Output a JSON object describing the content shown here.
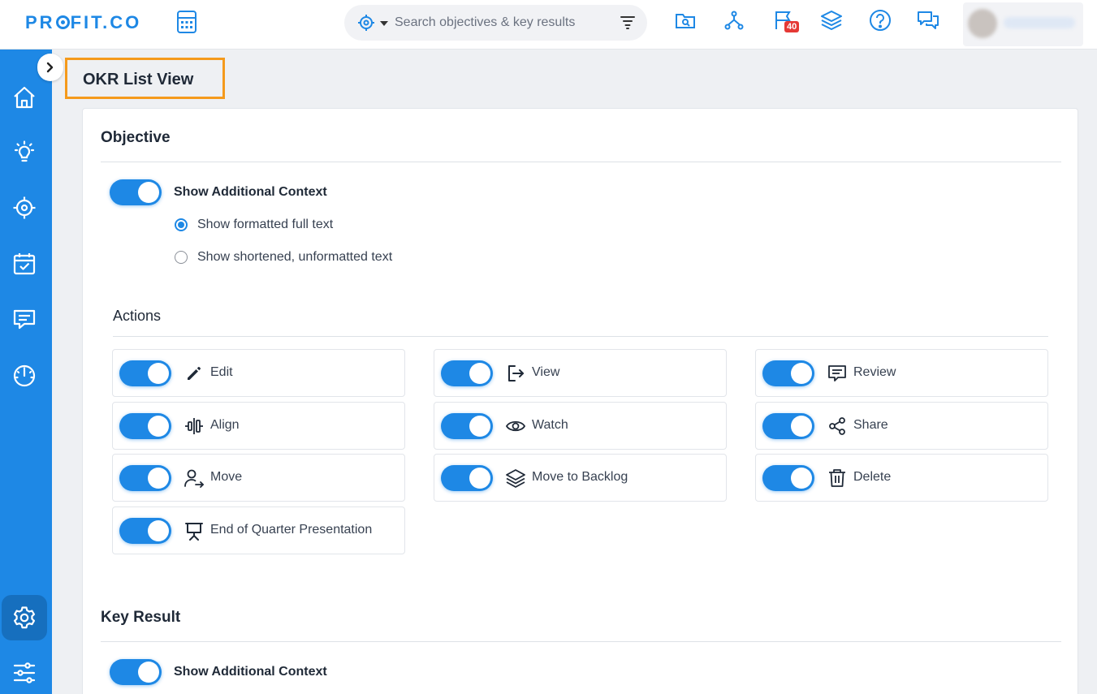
{
  "header": {
    "logo": "PROFIT.CO",
    "search_placeholder": "Search objectives & key results",
    "notification_count": "40"
  },
  "icons": {
    "top": [
      "calculator-icon",
      "target-icon",
      "filter-icon",
      "folder-search-icon",
      "org-hierarchy-icon",
      "flag-icon",
      "layers-icon",
      "help-icon",
      "chat-icon"
    ],
    "sidebar": [
      "home-icon",
      "bulb-icon",
      "target-icon",
      "calendar-check-icon",
      "message-icon",
      "dashboard-icon",
      "settings-icon",
      "sliders-icon"
    ]
  },
  "page": {
    "title": "OKR List View"
  },
  "objective": {
    "title": "Objective",
    "context_label": "Show Additional Context",
    "radio_full": "Show formatted full text",
    "radio_short": "Show shortened, unformatted text",
    "actions_title": "Actions",
    "actions": [
      {
        "label": "Edit",
        "icon": "pencil-icon"
      },
      {
        "label": "View",
        "icon": "open-exit-icon"
      },
      {
        "label": "Review",
        "icon": "review-comment-icon"
      },
      {
        "label": "Align",
        "icon": "align-icon"
      },
      {
        "label": "Watch",
        "icon": "eye-icon"
      },
      {
        "label": "Share",
        "icon": "share-icon"
      },
      {
        "label": "Move",
        "icon": "user-move-icon"
      },
      {
        "label": "Move to Backlog",
        "icon": "layers-icon"
      },
      {
        "label": "Delete",
        "icon": "trash-icon"
      },
      {
        "label": "End of Quarter Presentation",
        "icon": "presentation-icon"
      }
    ]
  },
  "key_result": {
    "title": "Key Result",
    "context_label": "Show Additional Context"
  },
  "colors": {
    "accent": "#1e88e5",
    "highlight": "#f59a1c",
    "badge": "#e53935"
  }
}
